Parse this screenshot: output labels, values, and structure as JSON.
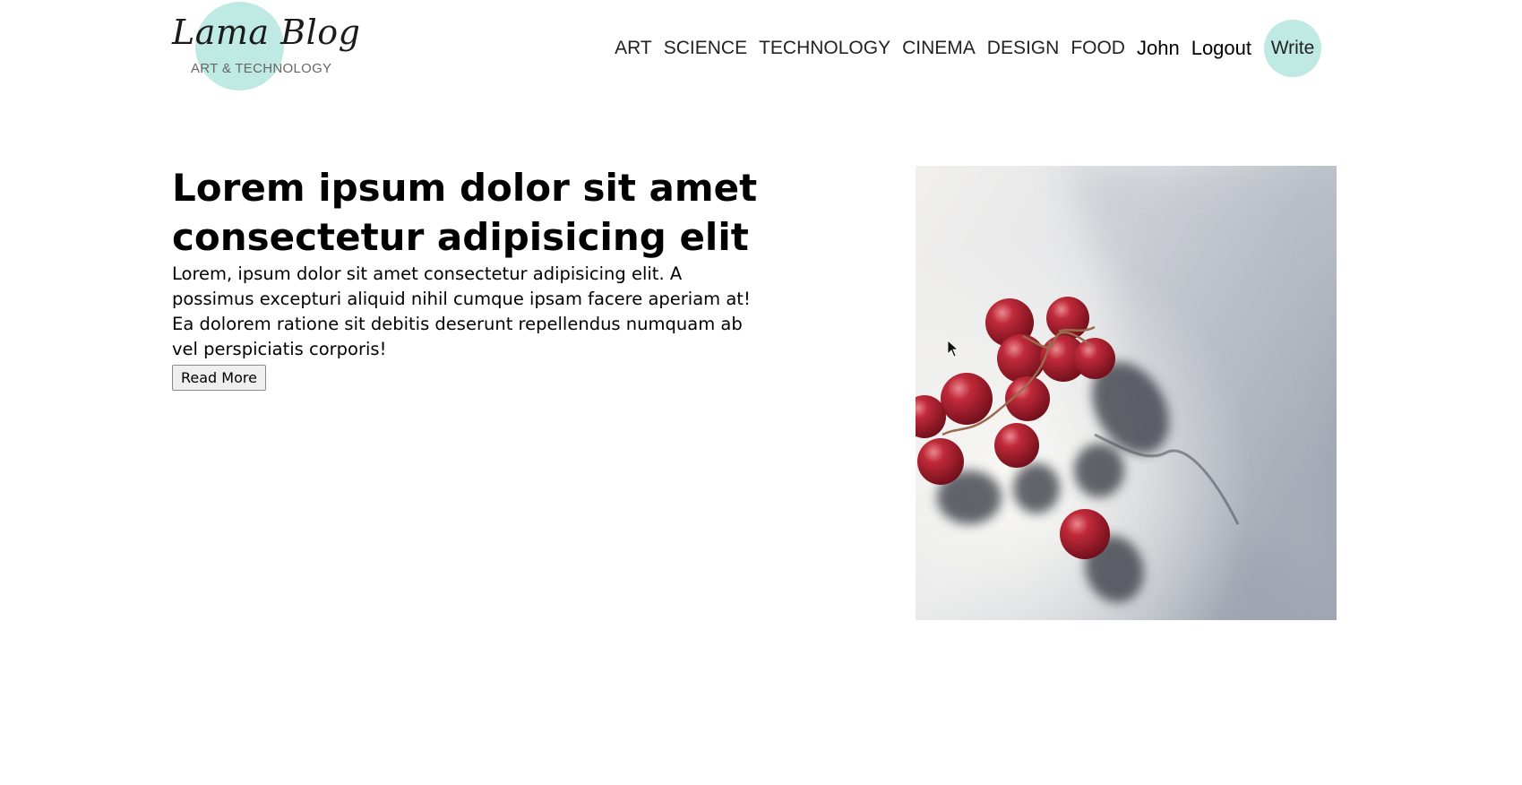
{
  "header": {
    "logo": {
      "title": "Lama Blog",
      "subtitle": "ART & TECHNOLOGY"
    },
    "nav": {
      "categories": [
        "ART",
        "SCIENCE",
        "TECHNOLOGY",
        "CINEMA",
        "DESIGN",
        "FOOD"
      ],
      "user": "John",
      "logout": "Logout",
      "write": "Write"
    }
  },
  "post": {
    "title": "Lorem ipsum dolor sit amet consectetur adipisicing elit",
    "description": "Lorem, ipsum dolor sit amet consectetur adipisicing elit. A possimus excepturi aliquid nihil cumque ipsam facere aperiam at! Ea dolorem ratione sit debitis deserunt repellendus numquam ab vel perspiciatis corporis!",
    "read_more": "Read More",
    "image": "red-grapes-photo"
  },
  "colors": {
    "accent": "#bfe9e3"
  }
}
